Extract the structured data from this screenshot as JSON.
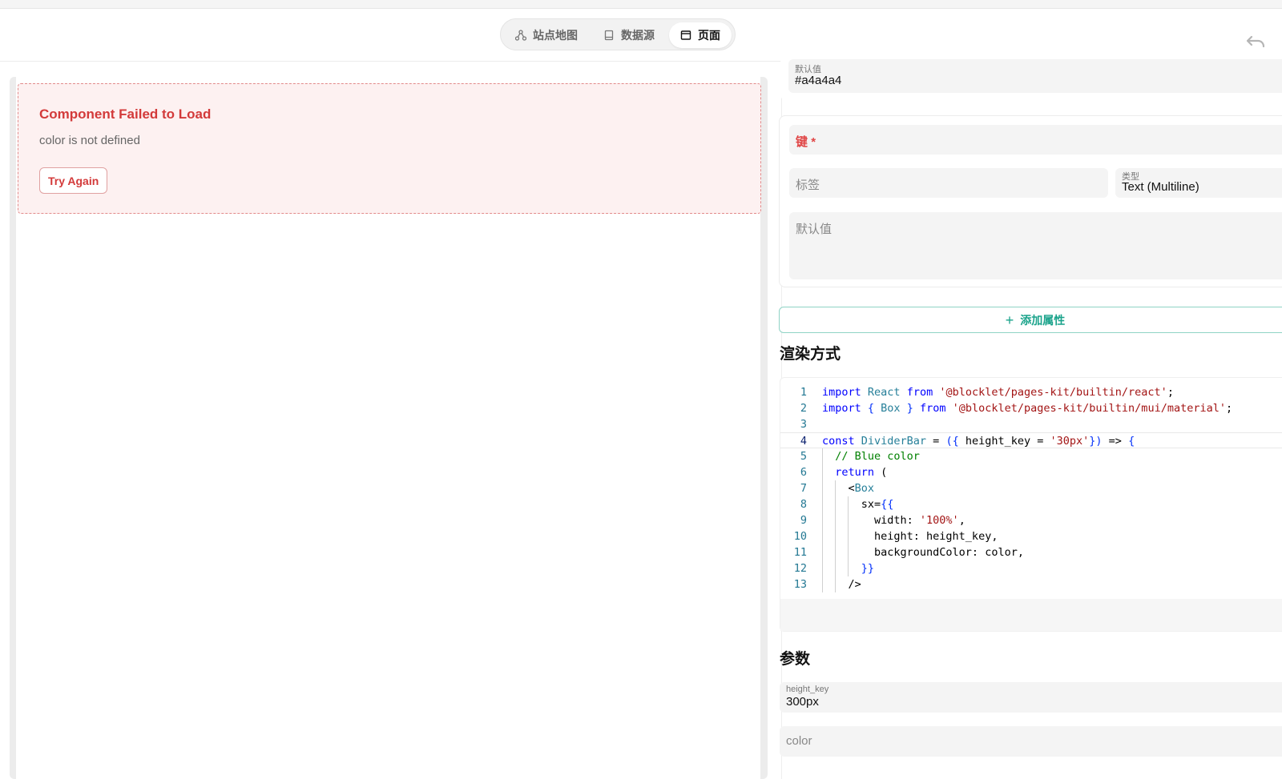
{
  "header": {
    "tabs": [
      {
        "label": "站点地图",
        "icon": "sitemap-icon",
        "active": false
      },
      {
        "label": "数据源",
        "icon": "database-icon",
        "active": false
      },
      {
        "label": "页面",
        "icon": "page-icon",
        "active": true
      }
    ],
    "undo_icon": "undo-icon"
  },
  "preview": {
    "error_title": "Component Failed to Load",
    "error_message": "color is not defined",
    "retry_label": "Try Again",
    "error_color": "#d33a3a"
  },
  "properties": {
    "prev_default_label": "默认值",
    "prev_default_value": "#a4a4a4",
    "key_label": "键",
    "key_required_mark": "*",
    "label_placeholder": "标签",
    "type_label": "类型",
    "type_value": "Text (Multiline)",
    "default_placeholder": "默认值",
    "add_property_label": "添加属性",
    "accent_color": "#1aa38b"
  },
  "render": {
    "title": "渲染方式",
    "code_lines": [
      [
        {
          "t": "import",
          "c": "kw"
        },
        {
          "t": " React ",
          "c": "ty"
        },
        {
          "t": "from",
          "c": "kw"
        },
        {
          "t": " "
        },
        {
          "t": "'@blocklet/pages-kit/builtin/react'",
          "c": "str"
        },
        {
          "t": ";"
        }
      ],
      [
        {
          "t": "import",
          "c": "kw"
        },
        {
          "t": " { ",
          "c": "br"
        },
        {
          "t": "Box",
          "c": "ty"
        },
        {
          "t": " } ",
          "c": "br"
        },
        {
          "t": "from",
          "c": "kw"
        },
        {
          "t": " "
        },
        {
          "t": "'@blocklet/pages-kit/builtin/mui/material'",
          "c": "str"
        },
        {
          "t": ";"
        }
      ],
      [],
      [
        {
          "t": "const",
          "c": "kw"
        },
        {
          "t": " DividerBar",
          "c": "ty"
        },
        {
          "t": " = "
        },
        {
          "t": "({",
          "c": "br"
        },
        {
          "t": " height_key = "
        },
        {
          "t": "'30px'",
          "c": "str"
        },
        {
          "t": "})",
          "c": "br"
        },
        {
          "t": " => "
        },
        {
          "t": "{",
          "c": "br"
        }
      ],
      [
        {
          "t": "  "
        },
        {
          "t": "// Blue color",
          "c": "cm"
        }
      ],
      [
        {
          "t": "  "
        },
        {
          "t": "return",
          "c": "kw"
        },
        {
          "t": " ("
        }
      ],
      [
        {
          "t": "    <"
        },
        {
          "t": "Box",
          "c": "ty"
        }
      ],
      [
        {
          "t": "      sx="
        },
        {
          "t": "{{",
          "c": "br"
        }
      ],
      [
        {
          "t": "        width: "
        },
        {
          "t": "'100%'",
          "c": "str"
        },
        {
          "t": ","
        }
      ],
      [
        {
          "t": "        height: height_key,"
        }
      ],
      [
        {
          "t": "        backgroundColor: color,"
        }
      ],
      [
        {
          "t": "      "
        },
        {
          "t": "}}",
          "c": "br"
        }
      ],
      [
        {
          "t": "    />"
        }
      ]
    ],
    "current_line": 4
  },
  "params": {
    "title": "参数",
    "height_key_label": "height_key",
    "height_key_value": "300px",
    "color_placeholder": "color"
  }
}
